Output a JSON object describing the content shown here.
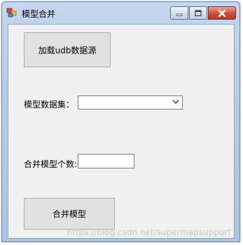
{
  "window": {
    "title": "模型合并",
    "icon": "app-form-icon",
    "caption_buttons": [
      "minimize-icon",
      "maximize-icon",
      "close-icon"
    ]
  },
  "form": {
    "load_button_label": "加载udb数据源",
    "dataset_label": "模型数据集：",
    "dataset_value": "",
    "count_label": "合并模型个数:",
    "count_value": "",
    "merge_button_label": "合并模型"
  },
  "watermark": "https://blog.csdn.net/supermapsupport"
}
